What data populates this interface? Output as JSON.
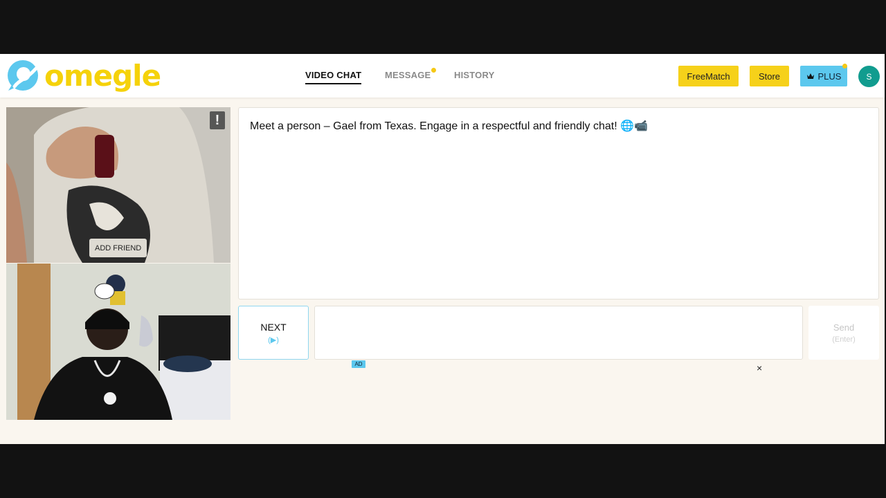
{
  "app": {
    "name": "omegle"
  },
  "nav": [
    {
      "label": "VIDEO CHAT",
      "active": true
    },
    {
      "label": "MESSAGE",
      "has_notification": true
    },
    {
      "label": "HISTORY"
    }
  ],
  "header_buttons": {
    "freematch": "FreeMatch",
    "store": "Store",
    "plus": "PLUS",
    "avatar_initial": "S"
  },
  "stranger_video": {
    "report_icon": "exclamation-icon",
    "add_friend_label": "ADD FRIEND"
  },
  "chat": {
    "message": "Meet a person – Gael from Texas. Engage in a respectful and friendly chat! 🌐📹"
  },
  "controls": {
    "next_label": "NEXT",
    "next_hint": "(▶)",
    "send_label": "Send",
    "send_hint": "(Enter)"
  },
  "ad": {
    "badge": "AD",
    "close": "×"
  },
  "colors": {
    "brand_yellow": "#f6d11a",
    "plus_blue": "#5cc8ee",
    "avatar_teal": "#119c8f",
    "logo_blue": "#5cc8ee",
    "background": "#faf6ef"
  }
}
